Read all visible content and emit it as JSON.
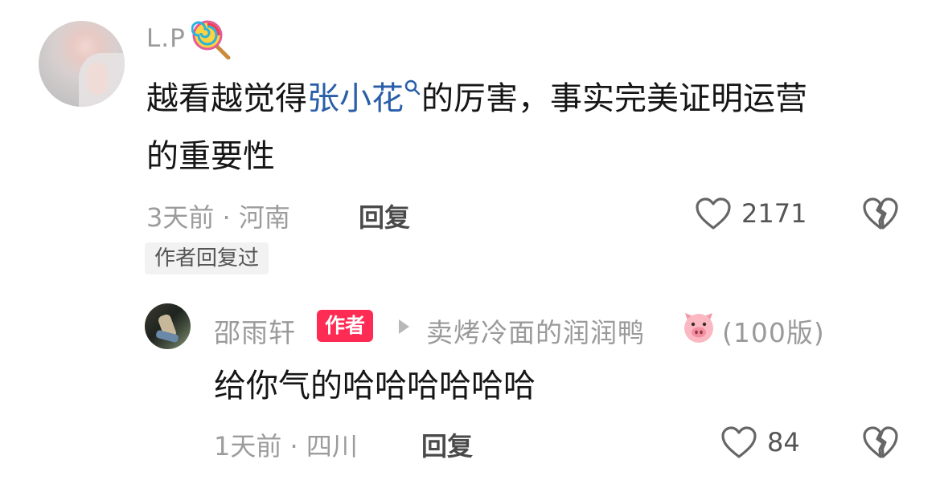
{
  "comment": {
    "username": "L.P",
    "text_before_link": "越看越觉得",
    "link_text": "张小花",
    "text_after_link": "的厉害，事实完美证明运营",
    "text_line2": "的重要性",
    "time_location": "3天前 · 河南",
    "reply_label": "回复",
    "like_count": "2171",
    "author_replied_label": "作者回复过"
  },
  "reply": {
    "username": "邵雨轩",
    "author_tag": "作者",
    "reply_to": "卖烤冷面的润润鸭",
    "reply_to_suffix": "(100版)",
    "text": "给你气的哈哈哈哈哈哈",
    "time_location": "1天前 · 四川",
    "reply_label": "回复",
    "like_count": "84"
  },
  "icons": {
    "lollipop": "lollipop-emoji-icon",
    "search": "search-icon",
    "heart": "heart-outline-icon",
    "dislike": "broken-heart-icon",
    "pig": "pig-emoji-icon",
    "arrow": "triangle-right-icon"
  },
  "colors": {
    "link": "#2a5ea8",
    "author_tag": "#fe2c55",
    "meta": "#9c9c9c"
  }
}
